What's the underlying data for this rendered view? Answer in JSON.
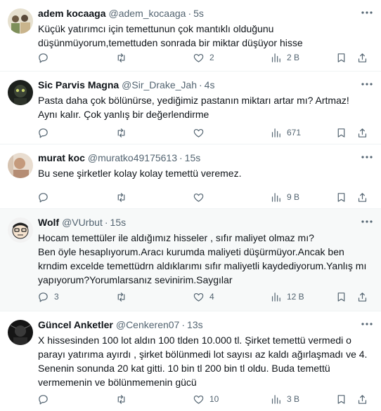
{
  "tweets": [
    {
      "name": "adem kocaaga",
      "handle": "@adem_kocaaga",
      "time": "5s",
      "text": "Küçük yatırımcı için temettunun çok mantıklı olduğunu\ndüşünmüyorum,temettuden sonrada bir miktar düşüyor hisse",
      "replies": "",
      "retweets": "",
      "likes": "2",
      "views": "2 B",
      "avatar_colors": [
        "#8c9c6c",
        "#d8c8a8"
      ]
    },
    {
      "name": "Sic Parvis Magna",
      "handle": "@Sir_Drake_Jah",
      "time": "4s",
      "text": "Pasta daha çok bölünürse, yediğimiz pastanın miktarı artar mı? Artmaz!\nAynı kalır. Çok yanlış bir değerlendirme",
      "replies": "",
      "retweets": "",
      "likes": "",
      "views": "671",
      "avatar_colors": [
        "#2a2f2a",
        "#6b8a4f"
      ]
    },
    {
      "name": "murat koc",
      "handle": "@muratko49175613",
      "time": "15s",
      "text": "Bu sene şirketler kolay kolay temettü veremez.",
      "replies": "",
      "retweets": "",
      "likes": "",
      "views": "9 B",
      "avatar_colors": [
        "#b89a82",
        "#e8d8c8"
      ]
    },
    {
      "name": "Wolf",
      "handle": "@VUrbut",
      "time": "15s",
      "text": "Hocam temettüler ile aldığımız hisseler , sıfır maliyet olmaz mı?\nBen öyle hesaplıyorum.Aracı kurumda maliyeti düşürmüyor.Ancak ben\nkrndim excelde temettüdrn aldıklarımı sıfır maliyetli kaydediyorum.Yanlış mı\nyapıyorum?Yorumlarsanız sevinirim.Saygılar",
      "replies": "3",
      "retweets": "",
      "likes": "4",
      "views": "12 B",
      "avatar_colors": [
        "#f0f0f0",
        "#222222"
      ]
    },
    {
      "name": "Güncel Anketler",
      "handle": "@Cenkeren07",
      "time": "13s",
      "text": "X hissesinden 100 lot aldın 100 tlden 10.000 tl. Şirket temettü vermedi o\nparayı yatırıma ayırdı , şirket bölünmedi lot sayısı az kaldı ağırlaşmadı ve 4.\nSenenin sonunda 20 kat gitti. 10 bin tl 200 bin tl oldu. Buda temettü\nvermemenin ve bölünmemenin gücü",
      "replies": "",
      "retweets": "",
      "likes": "10",
      "views": "3 B",
      "avatar_colors": [
        "#1a1a1a",
        "#555555"
      ]
    }
  ],
  "icons": {
    "reply": "reply-icon",
    "retweet": "retweet-icon",
    "like": "like-icon",
    "views": "views-icon",
    "bookmark": "bookmark-icon",
    "share": "share-icon",
    "more": "more-icon"
  }
}
